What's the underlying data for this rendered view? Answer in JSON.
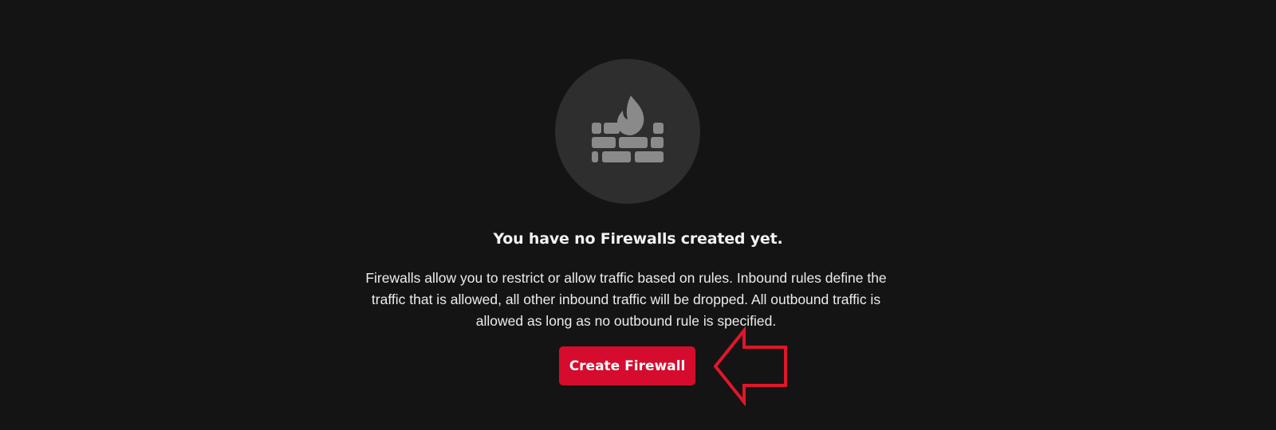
{
  "empty_state": {
    "icon": "firewall-icon",
    "title": "You have no Firewalls created yet.",
    "description": "Firewalls allow you to restrict or allow traffic based on rules. Inbound rules define the traffic that is allowed, all other inbound traffic will be dropped. All outbound traffic is allowed as long as no outbound rule is specified.",
    "create_button_label": "Create Firewall"
  },
  "annotation": {
    "icon": "arrow-left-icon",
    "color": "#e0162b"
  },
  "colors": {
    "background": "#141414",
    "icon_circle": "#2e2e2e",
    "icon_glyph": "#8a8a8a",
    "primary_button": "#d50c2d"
  }
}
